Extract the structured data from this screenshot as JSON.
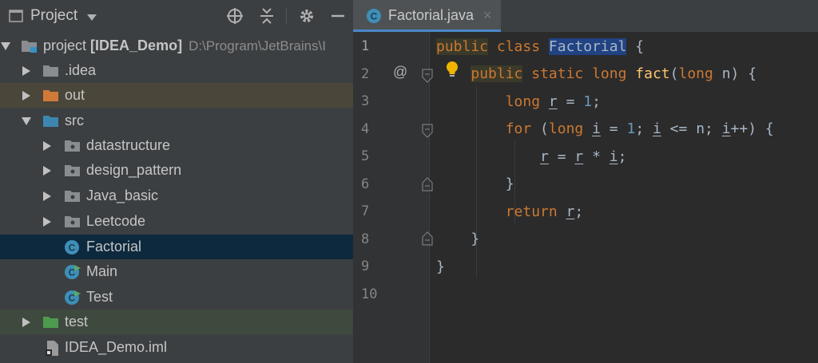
{
  "project_panel": {
    "title": "Project",
    "tree": [
      {
        "label": "project",
        "bold": "[IDEA_Demo]",
        "hint": "D:\\Program\\JetBrains\\I",
        "type": "module",
        "expanded": true
      },
      {
        "label": ".idea",
        "type": "folder",
        "expanded": false
      },
      {
        "label": "out",
        "type": "folder-excluded",
        "expanded": false
      },
      {
        "label": "src",
        "type": "folder-source",
        "expanded": true
      },
      {
        "label": "datastructure",
        "type": "package",
        "expanded": false
      },
      {
        "label": "design_pattern",
        "type": "package",
        "expanded": false
      },
      {
        "label": "Java_basic",
        "type": "package",
        "expanded": false
      },
      {
        "label": "Leetcode",
        "type": "package",
        "expanded": false
      },
      {
        "label": "Factorial",
        "type": "class",
        "selected": true
      },
      {
        "label": "Main",
        "type": "class-runnable"
      },
      {
        "label": "Test",
        "type": "class-runnable"
      },
      {
        "label": "test",
        "type": "folder-test",
        "expanded": false
      },
      {
        "label": "IDEA_Demo.iml",
        "type": "iml-file"
      }
    ]
  },
  "editor": {
    "tab": {
      "label": "Factorial.java",
      "close": "×",
      "icon": "class-icon"
    },
    "line_numbers": [
      "1",
      "2",
      "3",
      "4",
      "5",
      "6",
      "7",
      "8",
      "9",
      "10"
    ],
    "gutter_marker": "@",
    "code": [
      "public class Factorial {",
      "    public static long fact(long n) {",
      "        long r = 1;",
      "        for (long i = 1; i <= n; i++) {",
      "            r = r * i;",
      "        }",
      "        return r;",
      "    }",
      "}",
      ""
    ]
  },
  "colors": {
    "keyword": "#cc7832",
    "number": "#6897bb",
    "method": "#ffc66d",
    "text": "#a9b7c6",
    "selection": "#0d293e",
    "class_highlight": "#214283"
  }
}
